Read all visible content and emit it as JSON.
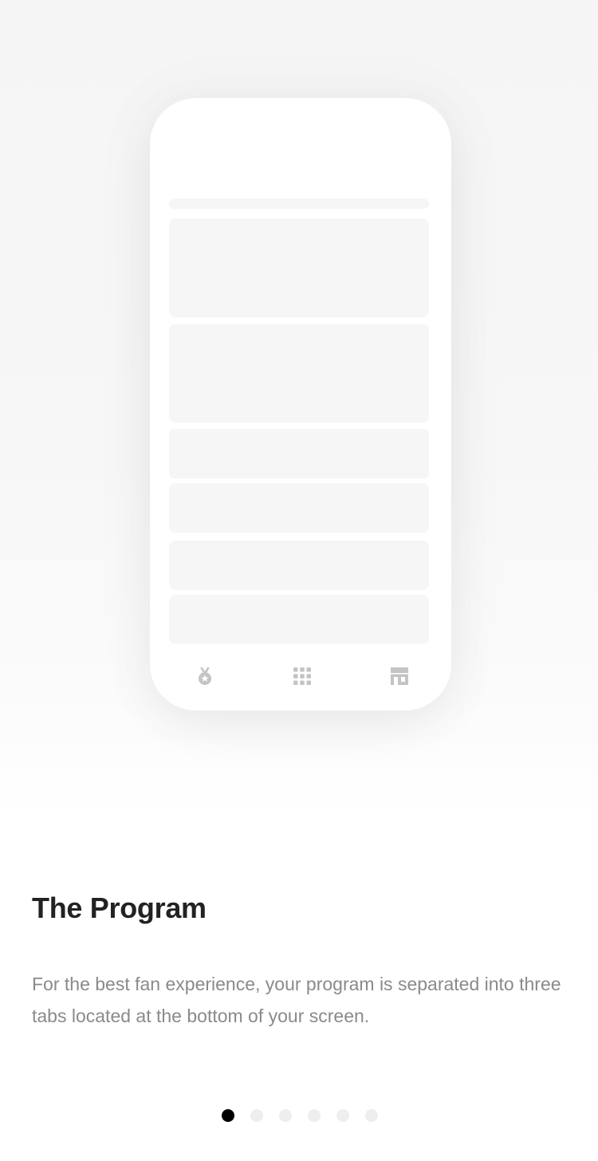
{
  "onboarding": {
    "title": "The Program",
    "description": "For the best fan experience, your program is separated into three tabs located at the bottom of your screen."
  },
  "phone_mockup": {
    "tabs": [
      {
        "icon": "medal-icon"
      },
      {
        "icon": "grid-icon"
      },
      {
        "icon": "store-icon"
      }
    ]
  },
  "pagination": {
    "total": 6,
    "active_index": 0,
    "active_color": "#000000",
    "inactive_color": "#eeeeee"
  }
}
